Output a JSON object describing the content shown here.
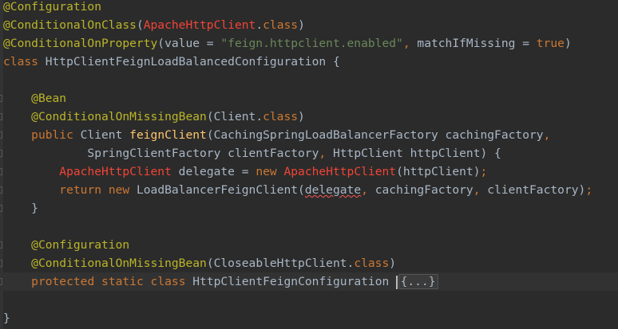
{
  "editor": {
    "lines": [
      {
        "tokens": [
          {
            "cls": "annotation",
            "text": "@Configuration"
          }
        ]
      },
      {
        "tokens": [
          {
            "cls": "annotation",
            "text": "@ConditionalOnClass"
          },
          {
            "cls": "",
            "text": "("
          },
          {
            "cls": "error-class",
            "text": "ApacheHttpClient"
          },
          {
            "cls": "",
            "text": "."
          },
          {
            "cls": "keyword",
            "text": "class"
          },
          {
            "cls": "",
            "text": ")"
          }
        ]
      },
      {
        "tokens": [
          {
            "cls": "annotation",
            "text": "@ConditionalOnProperty"
          },
          {
            "cls": "",
            "text": "(value = "
          },
          {
            "cls": "string",
            "text": "\"feign.httpclient.enabled\""
          },
          {
            "cls": "keyword",
            "text": ","
          },
          {
            "cls": "",
            "text": " matchIfMissing = "
          },
          {
            "cls": "keyword",
            "text": "true"
          },
          {
            "cls": "",
            "text": ")"
          }
        ]
      },
      {
        "tokens": [
          {
            "cls": "keyword",
            "text": "class"
          },
          {
            "cls": "",
            "text": " HttpClientFeignLoadBalancedConfiguration {"
          }
        ]
      },
      {
        "tokens": []
      },
      {
        "tokens": [
          {
            "cls": "",
            "text": "    "
          },
          {
            "cls": "annotation",
            "text": "@Bean"
          }
        ]
      },
      {
        "tokens": [
          {
            "cls": "",
            "text": "    "
          },
          {
            "cls": "annotation",
            "text": "@ConditionalOnMissingBean"
          },
          {
            "cls": "",
            "text": "(Client."
          },
          {
            "cls": "keyword",
            "text": "class"
          },
          {
            "cls": "",
            "text": ")"
          }
        ]
      },
      {
        "tokens": [
          {
            "cls": "",
            "text": "    "
          },
          {
            "cls": "keyword",
            "text": "public"
          },
          {
            "cls": "",
            "text": " Client "
          },
          {
            "cls": "method",
            "text": "feignClient"
          },
          {
            "cls": "",
            "text": "(CachingSpringLoadBalancerFactory cachingFactory"
          },
          {
            "cls": "keyword",
            "text": ","
          }
        ]
      },
      {
        "tokens": [
          {
            "cls": "",
            "text": "            SpringClientFactory clientFactory"
          },
          {
            "cls": "keyword",
            "text": ","
          },
          {
            "cls": "",
            "text": " HttpClient httpClient) {"
          }
        ]
      },
      {
        "tokens": [
          {
            "cls": "",
            "text": "        "
          },
          {
            "cls": "error-class",
            "text": "ApacheHttpClient"
          },
          {
            "cls": "",
            "text": " delegate = "
          },
          {
            "cls": "keyword",
            "text": "new"
          },
          {
            "cls": "",
            "text": " "
          },
          {
            "cls": "error-class",
            "text": "ApacheHttpClient"
          },
          {
            "cls": "",
            "text": "(httpClient)"
          },
          {
            "cls": "keyword",
            "text": ";"
          }
        ]
      },
      {
        "tokens": [
          {
            "cls": "",
            "text": "        "
          },
          {
            "cls": "keyword",
            "text": "return"
          },
          {
            "cls": "",
            "text": " "
          },
          {
            "cls": "keyword",
            "text": "new"
          },
          {
            "cls": "",
            "text": " LoadBalancerFeignClient("
          },
          {
            "cls": "typo",
            "text": "delegate"
          },
          {
            "cls": "keyword",
            "text": ","
          },
          {
            "cls": "",
            "text": " cachingFactory"
          },
          {
            "cls": "keyword",
            "text": ","
          },
          {
            "cls": "",
            "text": " clientFactory)"
          },
          {
            "cls": "keyword",
            "text": ";"
          }
        ]
      },
      {
        "tokens": [
          {
            "cls": "",
            "text": "    }"
          }
        ]
      },
      {
        "tokens": []
      },
      {
        "tokens": [
          {
            "cls": "",
            "text": "    "
          },
          {
            "cls": "annotation",
            "text": "@Configuration"
          }
        ]
      },
      {
        "tokens": [
          {
            "cls": "",
            "text": "    "
          },
          {
            "cls": "annotation",
            "text": "@ConditionalOnMissingBean"
          },
          {
            "cls": "",
            "text": "(CloseableHttpClient."
          },
          {
            "cls": "keyword",
            "text": "class"
          },
          {
            "cls": "",
            "text": ")"
          }
        ]
      },
      {
        "current": true,
        "tokens": [
          {
            "cls": "",
            "text": "    "
          },
          {
            "cls": "keyword",
            "text": "protected"
          },
          {
            "cls": "",
            "text": " "
          },
          {
            "cls": "keyword",
            "text": "static"
          },
          {
            "cls": "",
            "text": " "
          },
          {
            "cls": "keyword",
            "text": "class"
          },
          {
            "cls": "",
            "text": " HttpClientFeignConfiguration "
          },
          {
            "cls": "caret",
            "text": ""
          },
          {
            "cls": "folded",
            "text": "{...}"
          }
        ]
      },
      {
        "tokens": []
      },
      {
        "tokens": [
          {
            "cls": "",
            "text": "}"
          }
        ]
      }
    ],
    "marker_lines": [
      5,
      6,
      7,
      8,
      9,
      10,
      11,
      13,
      14,
      15
    ]
  }
}
